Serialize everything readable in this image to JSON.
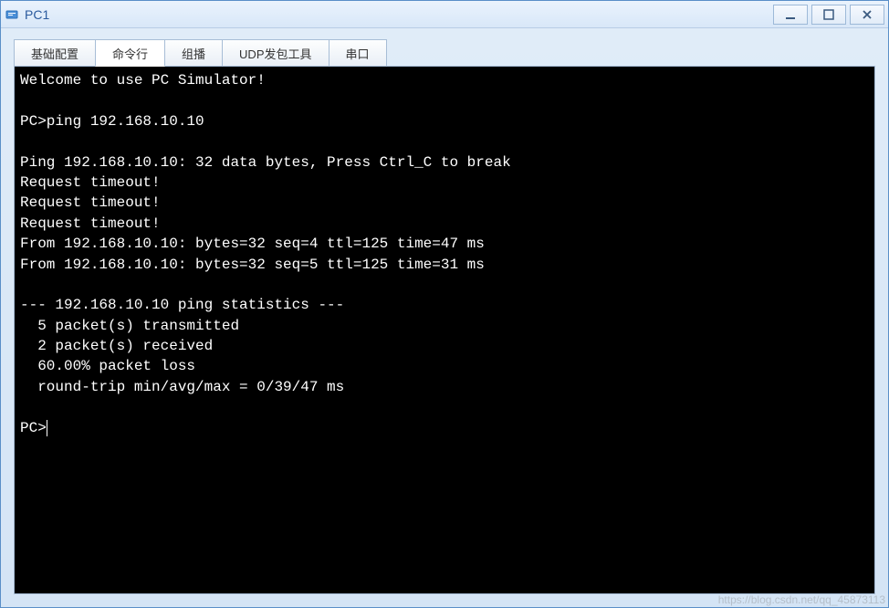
{
  "window": {
    "title": "PC1"
  },
  "tabs": [
    {
      "label": "基础配置",
      "active": false
    },
    {
      "label": "命令行",
      "active": true
    },
    {
      "label": "组播",
      "active": false
    },
    {
      "label": "UDP发包工具",
      "active": false
    },
    {
      "label": "串口",
      "active": false
    }
  ],
  "terminal": {
    "lines": [
      "Welcome to use PC Simulator!",
      "",
      "PC>ping 192.168.10.10",
      "",
      "Ping 192.168.10.10: 32 data bytes, Press Ctrl_C to break",
      "Request timeout!",
      "Request timeout!",
      "Request timeout!",
      "From 192.168.10.10: bytes=32 seq=4 ttl=125 time=47 ms",
      "From 192.168.10.10: bytes=32 seq=5 ttl=125 time=31 ms",
      "",
      "--- 192.168.10.10 ping statistics ---",
      "  5 packet(s) transmitted",
      "  2 packet(s) received",
      "  60.00% packet loss",
      "  round-trip min/avg/max = 0/39/47 ms",
      "",
      "PC>"
    ],
    "prompt_cursor": true
  },
  "watermark": "https://blog.csdn.net/qq_45873113"
}
